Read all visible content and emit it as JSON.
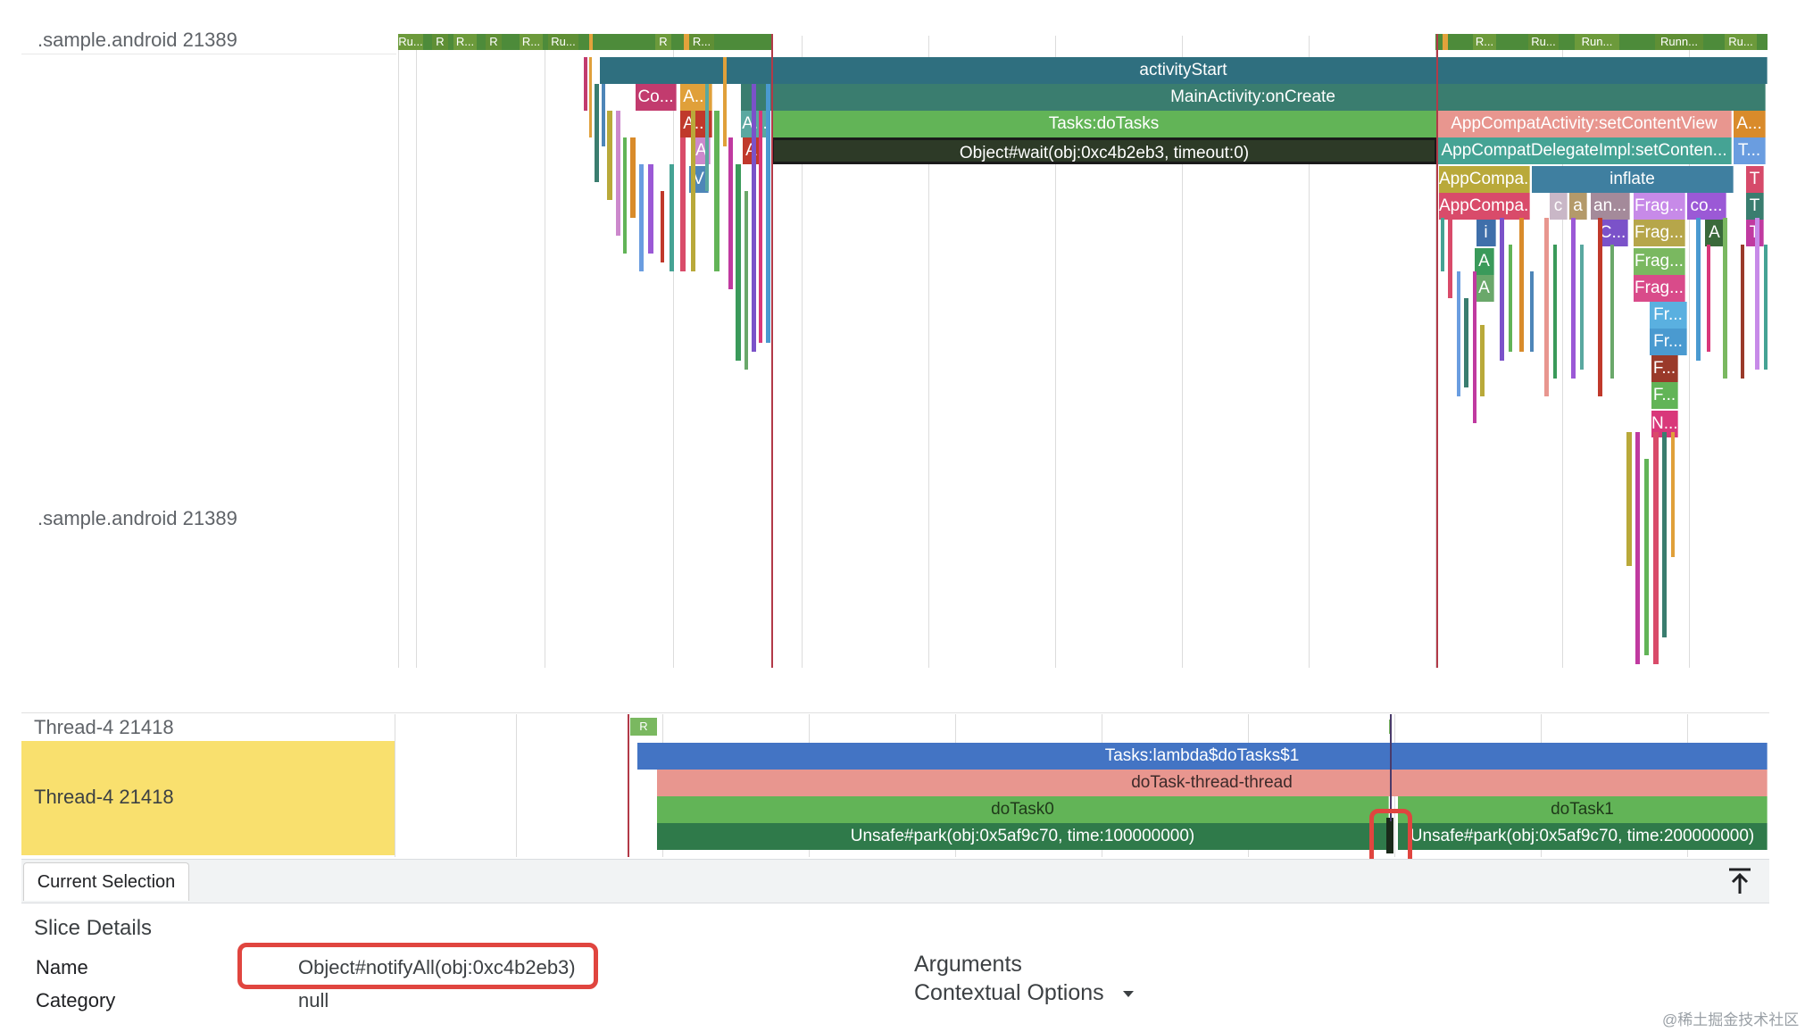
{
  "tracks": {
    "main_proc_label": ".sample.android 21389",
    "main_proc_label_2": ".sample.android 21389",
    "thread_row_label": "Thread-4 21418",
    "thread_row_label_2": "Thread-4 21418"
  },
  "main_states": [
    "Ru...",
    "R",
    "R...",
    "R",
    "R...",
    "Ru...",
    "R",
    "R..."
  ],
  "main_states_right": [
    "R...",
    "Ru...",
    "Run...",
    "Runn...",
    "Ru..."
  ],
  "thread_state": "R",
  "slices": {
    "activity_start": "activityStart",
    "main_on_create": "MainActivity:onCreate",
    "do_tasks": "Tasks:doTasks",
    "object_wait": "Object#wait(obj:0xc4b2eb3, timeout:0)",
    "set_content_view": "AppCompatActivity:setContentView",
    "delegate_set_content": "AppCompatDelegateImpl:setConten...",
    "inflate": "inflate",
    "appcompa_1": "AppCompa...",
    "appcompa_2": "AppCompa...",
    "small_a": "A...",
    "small_t": "T...",
    "small_co": "Co...",
    "small_a2": "A...",
    "small_a3": "A...",
    "small_a4": "A...",
    "small_A": "A",
    "small_A2": "A",
    "small_V": "V",
    "frag_1": "Frag...",
    "frag_2": "Frag...",
    "frag_3": "Frag...",
    "frag_4": "Frag...",
    "fr_1": "Fr...",
    "fr_2": "Fr...",
    "f_1": "F...",
    "f_2": "F...",
    "n_1": "N...",
    "c_label": "c",
    "a_label": "a",
    "an_label": "an...",
    "co_label": "co...",
    "i_label": "i",
    "c2_label": "C...",
    "T_label": "T",
    "lambda_do_tasks": "Tasks:lambda$doTasks$1",
    "do_task_thread": "doTask-thread-thread",
    "do_task0": "doTask0",
    "do_task1": "doTask1",
    "park_1": "Unsafe#park(obj:0x5af9c70, time:100000000)",
    "park_2": "Unsafe#park(obj:0x5af9c70, time:200000000)"
  },
  "details_panel": {
    "tab_label": "Current Selection",
    "section_title": "Slice Details",
    "name_label": "Name",
    "name_value": "Object#notifyAll(obj:0xc4b2eb3)",
    "category_label": "Category",
    "category_value": "null",
    "arguments_label": "Arguments",
    "contextual_options_label": "Contextual Options"
  },
  "watermark": "@稀土掘金技术社区",
  "colors": {
    "activity_start": "#2f6f7f",
    "on_create": "#3a7d6f",
    "do_tasks": "#62b457",
    "object_wait": "#2d3a27",
    "lambda": "#4374c4",
    "do_task_thread": "#e8968f",
    "do_task": "#62b457",
    "park": "#2f7a4a",
    "highlight_row": "#f9e06e",
    "annotation_red": "#e0453f"
  }
}
